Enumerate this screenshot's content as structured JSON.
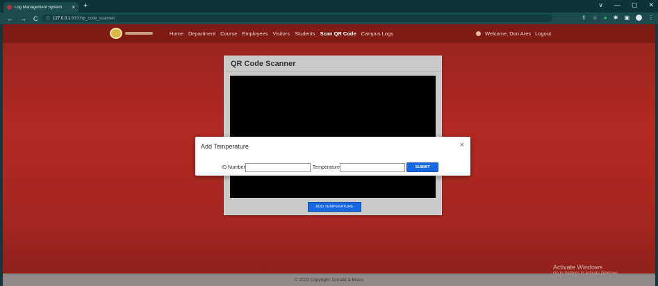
{
  "browser": {
    "tab_title": "Log Management System",
    "tab_close": "×",
    "new_tab": "+",
    "address_host": "127.0.0.1",
    "address_path": ":8000/qr_code_scanner/",
    "window_controls": [
      "∨",
      "—",
      "▢",
      "✕"
    ]
  },
  "nav": {
    "links": [
      "Home",
      "Department",
      "Course",
      "Employees",
      "Visitors",
      "Students",
      "Scan QR Code",
      "Campus Logs"
    ],
    "active": "Scan QR Code",
    "welcome": "Welcome, Don Ares",
    "logout": "Logout"
  },
  "scanner": {
    "title": "QR Code Scanner",
    "add_temperature_button": "ADD TEMPERATURE"
  },
  "modal": {
    "title": "Add Temperature",
    "close": "×",
    "id_label": "ID Number",
    "temperature_label": "Temperature",
    "id_value": "",
    "temperature_value": "",
    "submit_label": "SUBMIT"
  },
  "footer": {
    "text": "© 2023 Copyright: Donald & Braxs"
  },
  "watermark": {
    "title": "Activate Windows",
    "subtitle": "Go to Settings to activate Windows."
  },
  "colors": {
    "page_red": "#b32a22",
    "nav_red": "#7f1b15",
    "button_blue": "#1668e3",
    "browser_teal": "#1b4b4f"
  }
}
